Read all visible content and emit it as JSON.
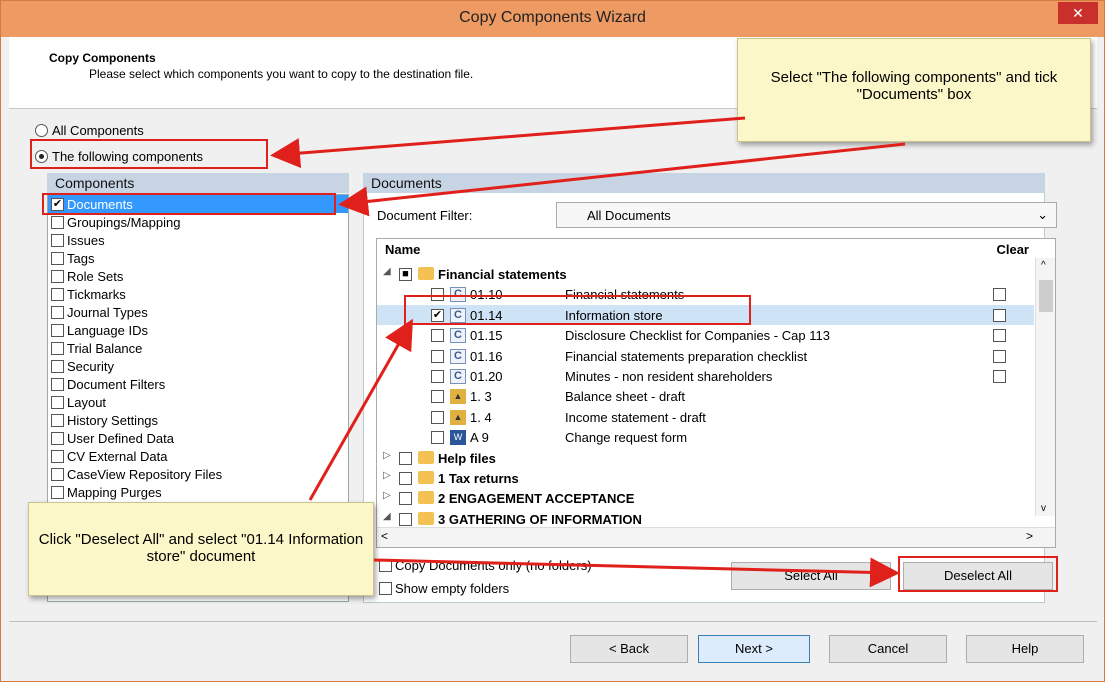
{
  "window": {
    "title": "Copy Components Wizard",
    "close_glyph": "✕"
  },
  "header": {
    "title": "Copy Components",
    "subtitle": "Please select which components you want to copy to the destination file."
  },
  "scope": {
    "all_label": "All Components",
    "following_label": "The following components",
    "selected": "following"
  },
  "components": {
    "heading": "Components",
    "items": [
      {
        "label": "Documents",
        "checked": true,
        "selected": true
      },
      {
        "label": "Groupings/Mapping",
        "checked": false
      },
      {
        "label": "Issues",
        "checked": false
      },
      {
        "label": "Tags",
        "checked": false
      },
      {
        "label": "Role Sets",
        "checked": false
      },
      {
        "label": "Tickmarks",
        "checked": false
      },
      {
        "label": "Journal Types",
        "checked": false
      },
      {
        "label": "Language IDs",
        "checked": false
      },
      {
        "label": "Trial Balance",
        "checked": false
      },
      {
        "label": "Security",
        "checked": false
      },
      {
        "label": "Document Filters",
        "checked": false
      },
      {
        "label": "Layout",
        "checked": false
      },
      {
        "label": "History Settings",
        "checked": false
      },
      {
        "label": "User Defined Data",
        "checked": false
      },
      {
        "label": "CV External Data",
        "checked": false
      },
      {
        "label": "CaseView Repository Files",
        "checked": false
      },
      {
        "label": "Mapping Purges",
        "checked": false
      }
    ]
  },
  "documents": {
    "heading": "Documents",
    "filter_label": "Document Filter:",
    "filter_value": "All Documents",
    "col_name": "Name",
    "col_clear": "Clear",
    "rows": [
      {
        "code": "Financial statements",
        "name": "",
        "level": 0,
        "type": "folder",
        "expand": "◢",
        "check": "■",
        "bold": true
      },
      {
        "code": "01.10",
        "name": "Financial statements",
        "level": 1,
        "type": "c",
        "check": "",
        "clear": true
      },
      {
        "code": "01.14",
        "name": "Information store",
        "level": 1,
        "type": "c",
        "check": "✔",
        "clear": true,
        "highlight": true
      },
      {
        "code": "01.15",
        "name": "Disclosure Checklist for Companies - Cap 113",
        "level": 1,
        "type": "c",
        "check": "",
        "clear": true
      },
      {
        "code": "01.16",
        "name": "Financial statements preparation checklist",
        "level": 1,
        "type": "c",
        "check": "",
        "clear": true
      },
      {
        "code": "01.20",
        "name": "Minutes - non resident shareholders",
        "level": 1,
        "type": "c",
        "check": "",
        "clear": true
      },
      {
        "code": "1. 3",
        "name": "Balance sheet - draft",
        "level": 1,
        "type": "x",
        "check": ""
      },
      {
        "code": "1. 4",
        "name": "Income statement - draft",
        "level": 1,
        "type": "x",
        "check": ""
      },
      {
        "code": "A 9",
        "name": "Change request form",
        "level": 1,
        "type": "w",
        "check": ""
      },
      {
        "code": "Help files",
        "name": "",
        "level": 0,
        "type": "folder",
        "expand": "▷",
        "check": "",
        "bold": true
      },
      {
        "code": "1 Tax returns",
        "name": "",
        "level": 0,
        "type": "folder",
        "expand": "▷",
        "check": "",
        "bold": true
      },
      {
        "code": "2 ENGAGEMENT ACCEPTANCE",
        "name": "",
        "level": 0,
        "type": "folder",
        "expand": "▷",
        "check": "",
        "bold": true
      },
      {
        "code": "3 GATHERING OF INFORMATION",
        "name": "",
        "level": 0,
        "type": "folder",
        "expand": "◢",
        "check": "",
        "bold": true
      }
    ],
    "copy_only_label": "Copy Documents only (no folders)",
    "show_empty_label": "Show empty folders",
    "select_all": "Select All",
    "deselect_all": "Deselect All"
  },
  "footer": {
    "back": "< Back",
    "next": "Next >",
    "cancel": "Cancel",
    "help": "Help"
  },
  "callouts": {
    "top": "Select \"The following components\" and tick \"Documents\" box",
    "bottom": "Click \"Deselect All\" and select \"01.14 Information store\" document"
  },
  "colors": {
    "titlebar": "#ee9a63",
    "annotation_red": "#e0201b",
    "callout_bg": "#fbf7c9",
    "selection": "#3399ff"
  }
}
